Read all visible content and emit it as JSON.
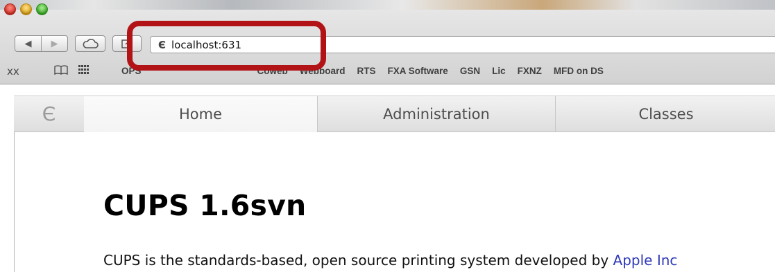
{
  "browser": {
    "url": "localhost:631",
    "bookmarks": [
      "OPS",
      "Coweb",
      "Webboard",
      "RTS",
      "FXA Software",
      "GSN",
      "Lic",
      "FXNZ",
      "MFD on DS"
    ]
  },
  "icons": {
    "favicon": "cups-logo-icon",
    "back": "back-arrow-icon",
    "forward": "forward-arrow-icon",
    "icloud": "cloud-icon",
    "share": "share-icon",
    "reading_list": "reading-glasses-icon",
    "bookmarks_book": "open-book-icon",
    "top_sites": "grid-icon"
  },
  "cups_nav": {
    "tabs": [
      "Home",
      "Administration",
      "Classes"
    ],
    "active": "Home"
  },
  "page": {
    "heading": "CUPS 1.6svn",
    "intro_text": "CUPS is the standards-based, open source printing system developed by ",
    "intro_link": "Apple Inc"
  },
  "colors": {
    "annotation": "#b21316",
    "link": "#2f39b8"
  }
}
